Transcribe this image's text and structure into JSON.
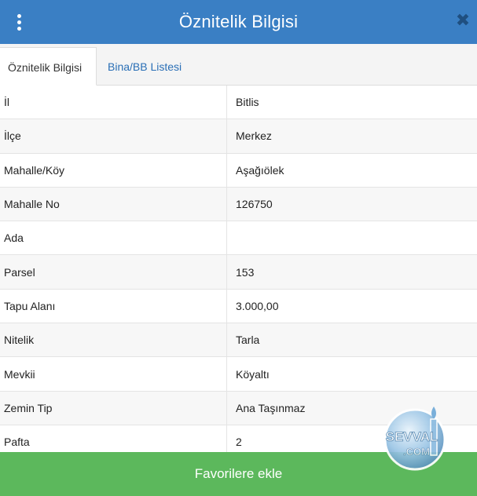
{
  "header": {
    "title": "Öznitelik Bilgisi"
  },
  "tabs": [
    {
      "label": "Öznitelik Bilgisi",
      "active": true
    },
    {
      "label": "Bina/BB Listesi",
      "active": false
    }
  ],
  "rows": [
    {
      "key": "İl",
      "value": "Bitlis"
    },
    {
      "key": "İlçe",
      "value": "Merkez"
    },
    {
      "key": "Mahalle/Köy",
      "value": "Aşağıölek"
    },
    {
      "key": "Mahalle No",
      "value": "126750"
    },
    {
      "key": "Ada",
      "value": ""
    },
    {
      "key": "Parsel",
      "value": "153"
    },
    {
      "key": "Tapu Alanı",
      "value": "3.000,00"
    },
    {
      "key": "Nitelik",
      "value": "Tarla"
    },
    {
      "key": "Mevkii",
      "value": "Köyaltı"
    },
    {
      "key": "Zemin Tip",
      "value": "Ana Taşınmaz"
    },
    {
      "key": "Pafta",
      "value": "2"
    }
  ],
  "footer": {
    "button_label": "Favorilere ekle"
  },
  "watermark": {
    "line1": "SEVVAL",
    "line2": ".COM"
  },
  "colors": {
    "header": "#3a7fc4",
    "tab_link": "#2a6fb6",
    "footer": "#5cb85c"
  }
}
